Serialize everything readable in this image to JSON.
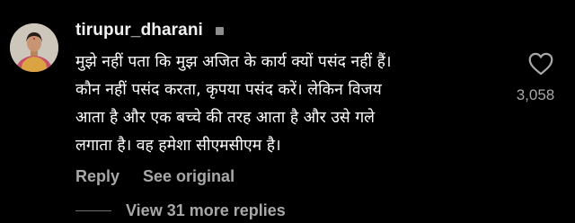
{
  "comment": {
    "username": "tirupur_dharani",
    "more_icon": "square-dot-icon",
    "text_lines": [
      "मुझे नहीं पता कि मुझ अजित के कार्य क्यों पसंद नहीं हैं।",
      "कौन नहीं पसंद करता, कृपया पसंद करें। लेकिन विजय",
      "आता है और एक बच्चे की तरह आता है और उसे गले",
      "लगाता है। वह हमेशा सीएमसीएम है।"
    ],
    "like_icon": "heart-outline-icon",
    "like_count": "3,058",
    "reply_label": "Reply",
    "see_original_label": "See original",
    "view_replies_label": "View 31 more replies"
  },
  "colors": {
    "background": "#000000",
    "text_primary": "#ffffff",
    "text_secondary": "#a8a8a8"
  }
}
